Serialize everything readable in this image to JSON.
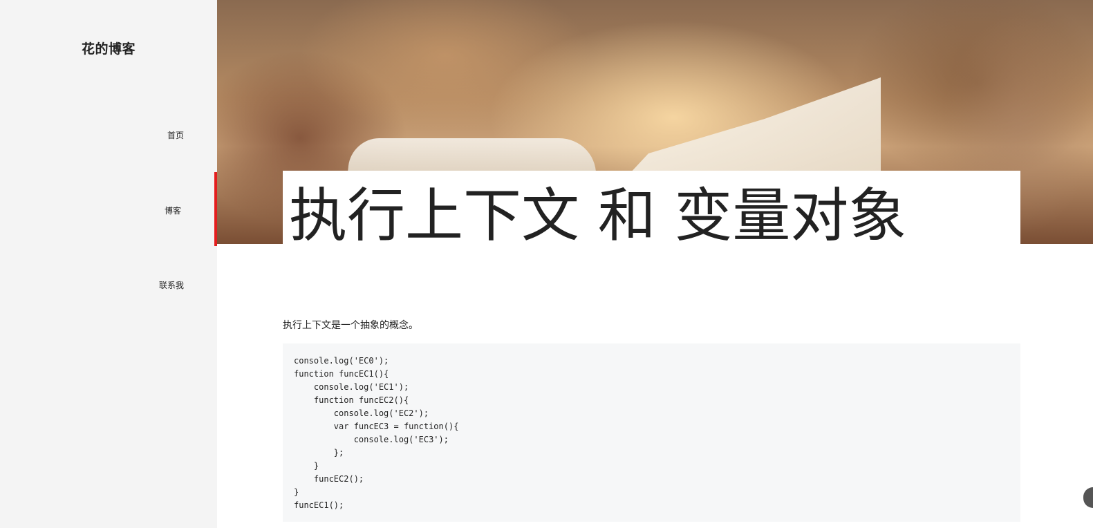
{
  "sidebar": {
    "brand": "花的博客",
    "nav": [
      {
        "label": "首页"
      },
      {
        "label": "博客",
        "active": true
      },
      {
        "label": "联系我"
      }
    ],
    "active_color": "#e41e1e"
  },
  "article": {
    "title": "执行上下文 和 变量对象",
    "intro": "执行上下文是一个抽象的概念。",
    "code_lines": [
      "console.log('EC0');",
      "function funcEC1(){",
      "    console.log('EC1');",
      "    function funcEC2(){",
      "        console.log('EC2');",
      "        var funcEC3 = function(){",
      "            console.log('EC3');",
      "        };",
      "    }",
      "    funcEC2();",
      "}",
      "funcEC1();"
    ]
  },
  "hero": {
    "image": "open-book-photo"
  }
}
